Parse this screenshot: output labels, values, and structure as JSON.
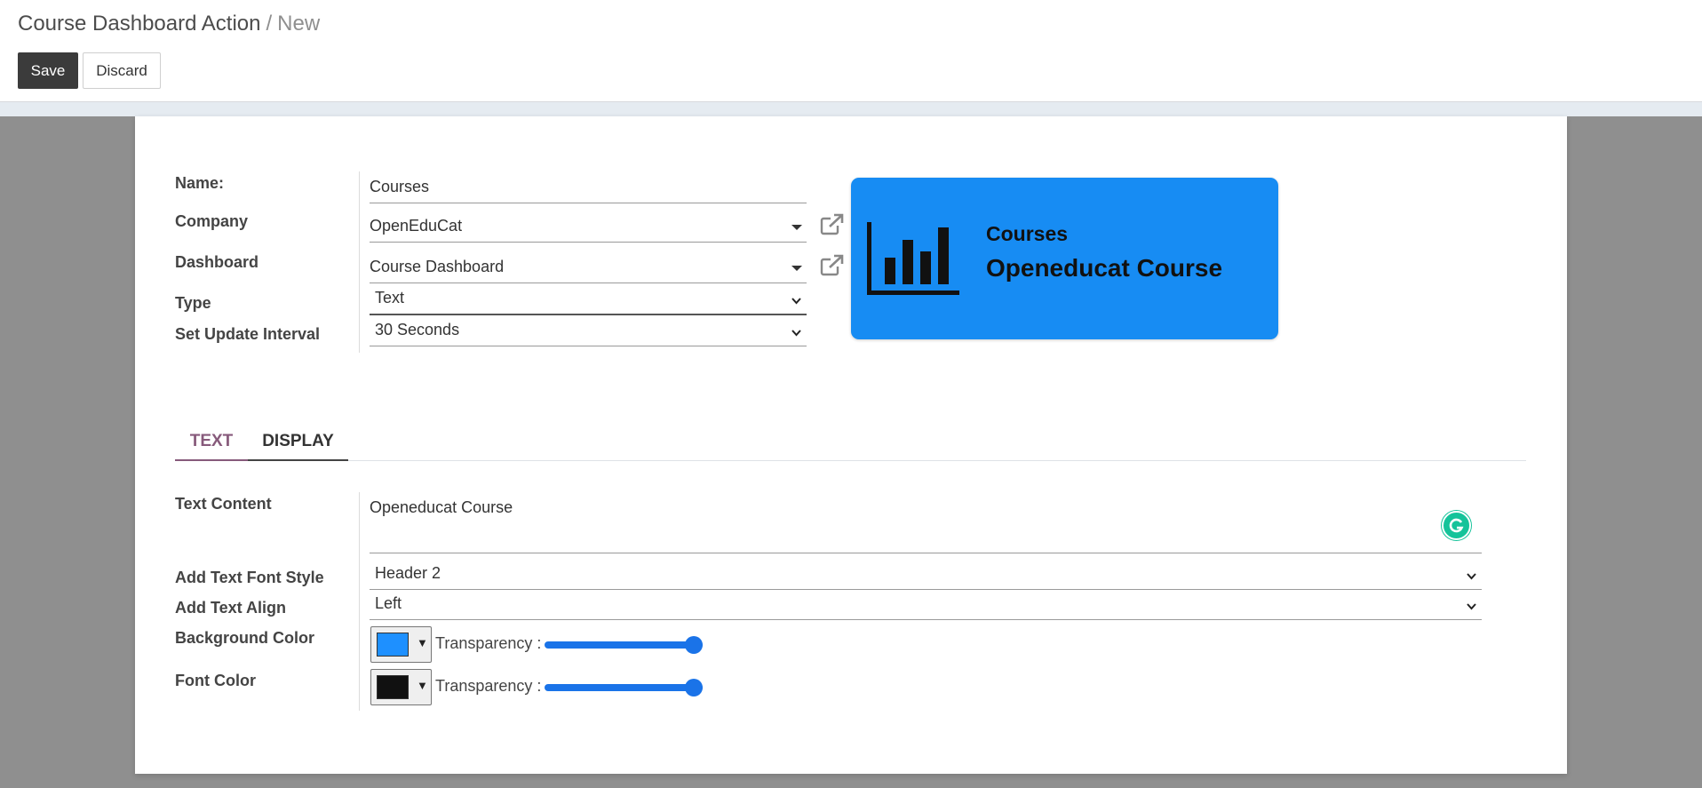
{
  "breadcrumb": {
    "parent": "Course Dashboard Action",
    "separator": "/",
    "current": "New"
  },
  "buttons": {
    "save": "Save",
    "discard": "Discard"
  },
  "form": {
    "name": {
      "label": "Name:",
      "value": "Courses"
    },
    "company": {
      "label": "Company",
      "value": "OpenEduCat"
    },
    "dashboard": {
      "label": "Dashboard",
      "value": "Course Dashboard"
    },
    "type": {
      "label": "Type",
      "value": "Text"
    },
    "interval": {
      "label": "Set Update Interval",
      "value": "30 Seconds"
    }
  },
  "preview": {
    "title": "Courses",
    "content": "Openeducat Course",
    "background": "#178cf3"
  },
  "tabs": [
    {
      "label": "TEXT",
      "active": true
    },
    {
      "label": "DISPLAY",
      "active": false
    }
  ],
  "text_tab": {
    "text_content": {
      "label": "Text Content",
      "value": "Openeducat Course"
    },
    "font_style": {
      "label": "Add Text Font Style",
      "value": "Header 2"
    },
    "text_align": {
      "label": "Add Text Align",
      "value": "Left"
    },
    "background_color": {
      "label": "Background Color",
      "color": "#1e90ff",
      "transparency_label": "Transparency :",
      "transparency": 1.0
    },
    "font_color": {
      "label": "Font Color",
      "color": "#111111",
      "transparency_label": "Transparency :",
      "transparency": 1.0
    }
  },
  "colors": {
    "accent": "#875a7b",
    "primary_button": "#3b3b3b",
    "slider": "#1a73e8"
  }
}
